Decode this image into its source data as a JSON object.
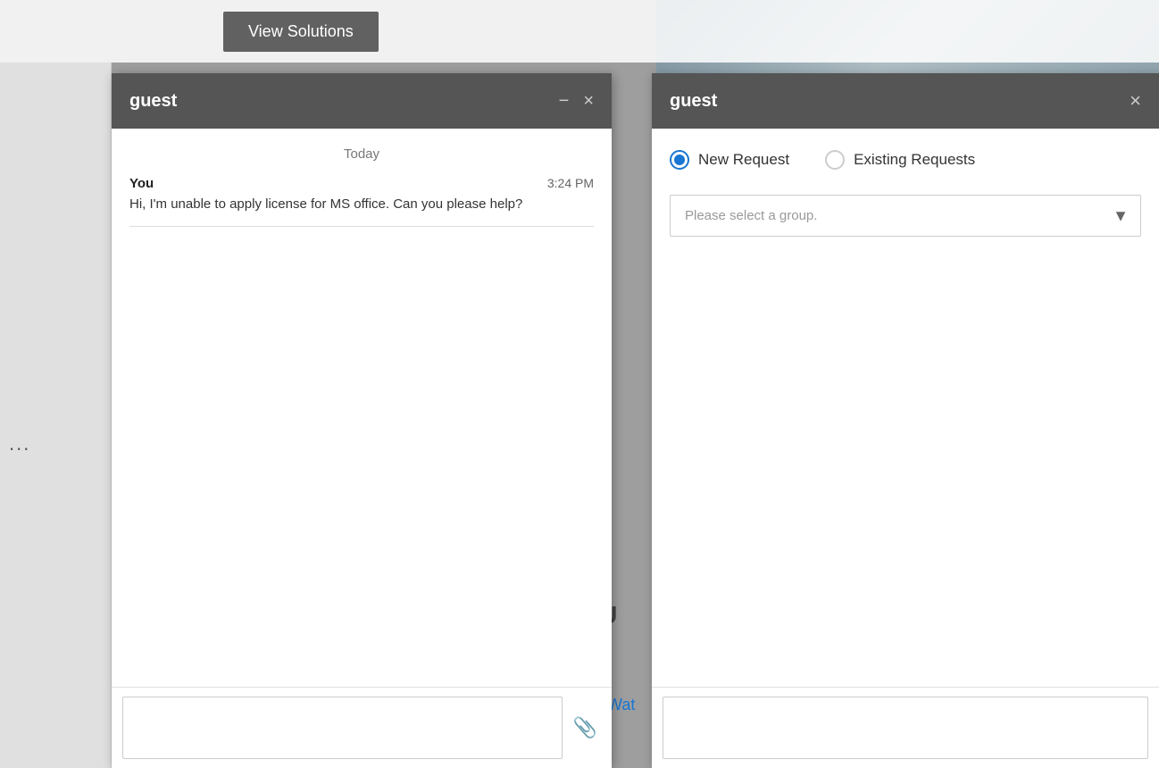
{
  "background": {
    "color": "#9e9e9e"
  },
  "top_bar": {
    "view_solutions_label": "View Solutions"
  },
  "partial_labels": {
    "al_u": "al U",
    "wat": "Wat"
  },
  "chat_panel": {
    "title": "guest",
    "minimize_label": "−",
    "close_label": "×",
    "date_divider": "Today",
    "message": {
      "sender": "You",
      "time": "3:24 PM",
      "text": "Hi, I'm unable to apply license for MS office. Can you please help?"
    },
    "input_placeholder": "",
    "attachment_icon": "📎"
  },
  "request_panel": {
    "title": "guest",
    "close_label": "×",
    "new_request_label": "New Request",
    "existing_requests_label": "Existing Requests",
    "group_placeholder": "Please select a group.",
    "input_placeholder": ""
  }
}
